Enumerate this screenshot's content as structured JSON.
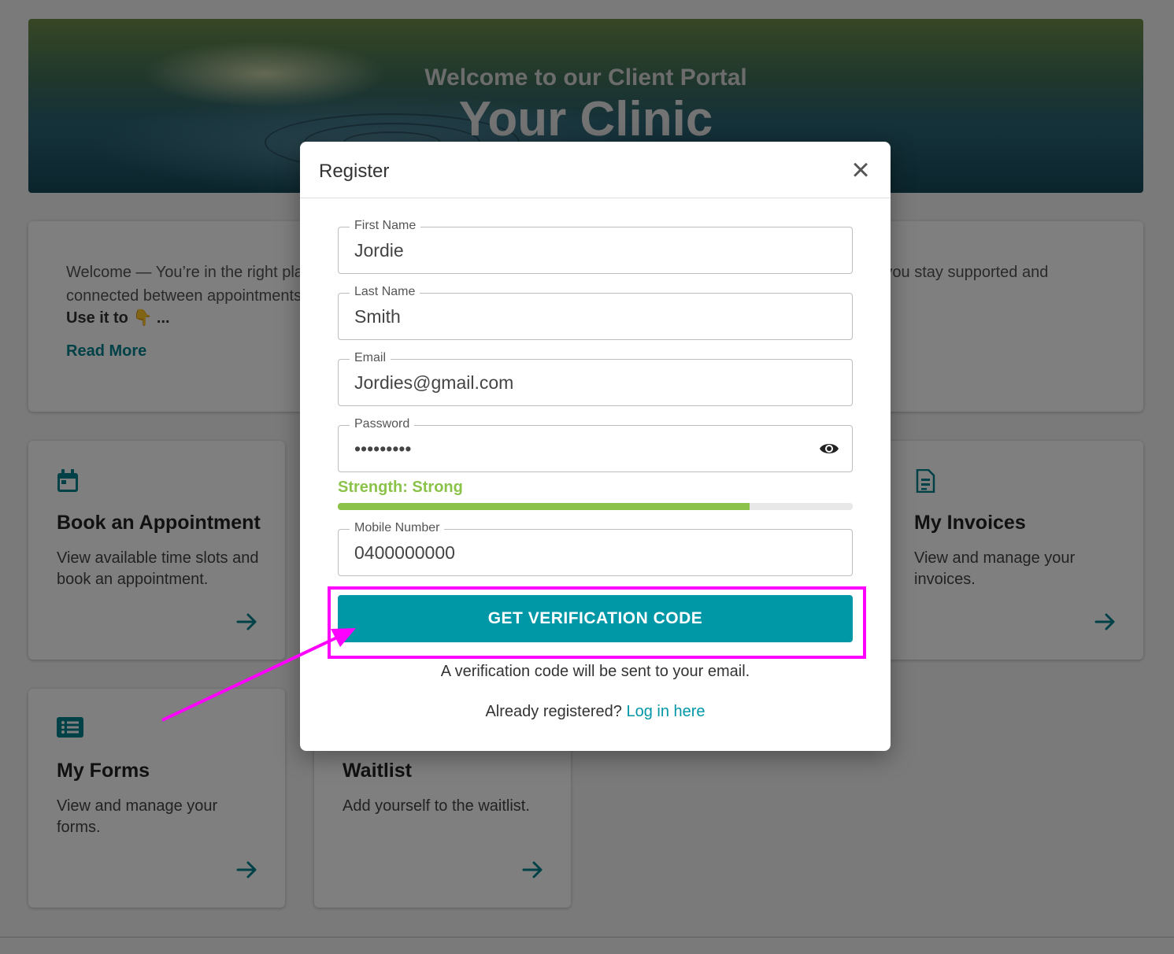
{
  "hero": {
    "subtitle": "Welcome to our Client Portal",
    "title": "Your Clinic"
  },
  "welcome": {
    "text": "Welcome — You’re in the right place. We’re glad you’re here, and you’re respected — always. This client portal helps you stay supported and connected between appointments.",
    "use_it": "Use it to 👇 ...",
    "read_more": "Read More"
  },
  "tiles": [
    {
      "title": "Book an Appointment",
      "desc": "View available time slots and book an appointment.",
      "icon": "calendar-icon"
    },
    {
      "title": "My Invoices",
      "desc": "View and manage your invoices.",
      "icon": "invoice-icon"
    },
    {
      "title": "My Forms",
      "desc": "View and manage your forms.",
      "icon": "list-icon"
    },
    {
      "title": "Waitlist",
      "desc": "Add yourself to the waitlist.",
      "icon": "clock-icon"
    }
  ],
  "modal": {
    "title": "Register",
    "close": "×",
    "fields": {
      "first_name": {
        "label": "First Name",
        "value": "Jordie"
      },
      "last_name": {
        "label": "Last Name",
        "value": "Smith"
      },
      "email": {
        "label": "Email",
        "value": "Jordies@gmail.com"
      },
      "password": {
        "label": "Password",
        "value": "Password1"
      },
      "mobile": {
        "label": "Mobile Number",
        "value": "0400000000"
      }
    },
    "strength_label": "Strength: Strong",
    "strength_fraction": 0.8,
    "button": "GET VERIFICATION CODE",
    "note": "A verification code will be sent to your email.",
    "already": "Already registered?",
    "login_link": "Log in here"
  },
  "colors": {
    "accent": "#0097a7",
    "strength": "#8bc34a",
    "annotation": "#ff00ff"
  }
}
